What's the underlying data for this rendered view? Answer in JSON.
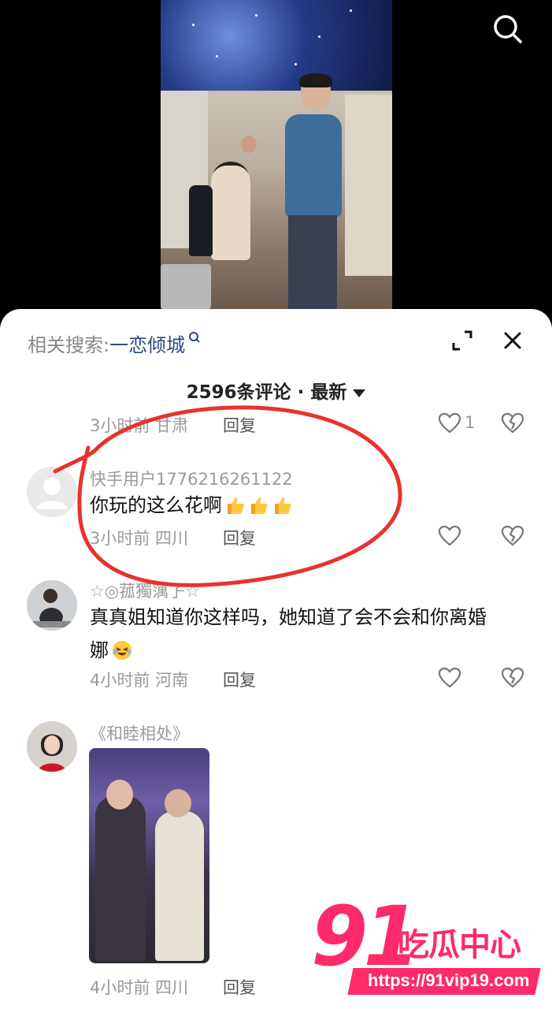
{
  "top": {
    "search_icon": "search-icon"
  },
  "sheet": {
    "related_label": "相关搜索:",
    "related_term": "一恋倾城",
    "count_label": "2596条评论 · 最新",
    "icons": {
      "expand": "expand-icon",
      "close": "close-icon"
    }
  },
  "comments": [
    {
      "meta": "3小时前 甘肃",
      "reply": "回复",
      "likes": "1"
    },
    {
      "username": "快手用户1776216261122",
      "text": "你玩的这么花啊",
      "emoji": "thumbs-up x3",
      "meta": "3小时前 四川",
      "reply": "回复"
    },
    {
      "username": "☆◎菰獨蕅孒☆",
      "text_line1": "真真姐知道你这样吗，她知道了会不会和你离婚",
      "text_line2": "娜",
      "emoji": "grimace-laugh",
      "meta": "4小时前 河南",
      "reply": "回复"
    },
    {
      "username": "《和睦相处》",
      "meta": "4小时前 四川",
      "reply": "回复"
    }
  ],
  "watermark": {
    "number": "91",
    "brand": "吃瓜中心",
    "url": "https://91vip19.com"
  },
  "colors": {
    "accent": "#2b4a84",
    "annotation": "#e8322e",
    "watermark": "#ff2a6a"
  }
}
